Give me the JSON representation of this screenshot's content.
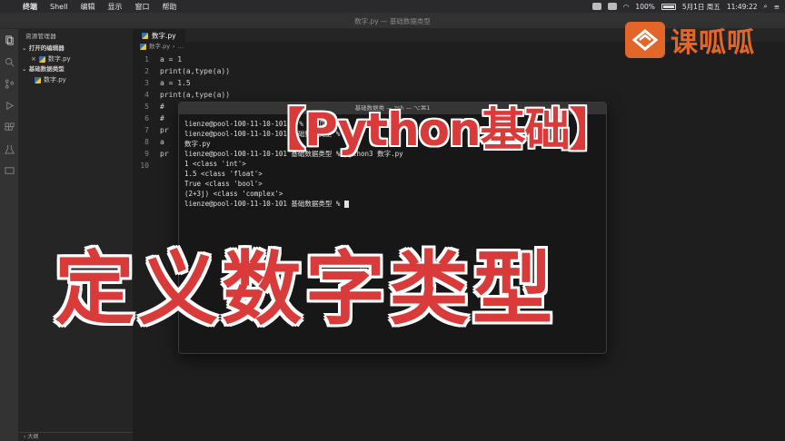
{
  "menubar": {
    "items": [
      "终端",
      "Shell",
      "编辑",
      "显示",
      "窗口",
      "帮助"
    ],
    "status": {
      "battery": "100%",
      "date": "5月1日 周五",
      "time": "11:49:22"
    }
  },
  "window": {
    "title": "数字.py — 基础数据类型"
  },
  "sidebar": {
    "header": "资源管理器",
    "open_editors_label": "打开的编辑器",
    "open_file": "数字.py",
    "folder_label": "基础数据类型",
    "folder_file": "数字.py",
    "outline_label": "大纲"
  },
  "editor": {
    "tab_label": "数字.py",
    "breadcrumb": "数字.py",
    "lines": [
      {
        "no": "1",
        "text": "a = 1"
      },
      {
        "no": "2",
        "text": "print(a,type(a))"
      },
      {
        "no": "3",
        "text": "a = 1.5"
      },
      {
        "no": "4",
        "text": "print(a,type(a))"
      },
      {
        "no": "5",
        "text": "#"
      },
      {
        "no": "6",
        "text": "#"
      },
      {
        "no": "7",
        "text": "pr"
      },
      {
        "no": "8",
        "text": "a"
      },
      {
        "no": "9",
        "text": "pr"
      },
      {
        "no": "10",
        "text": ""
      }
    ]
  },
  "terminal": {
    "title": "基础数据类 — zsh — ⌥⌘1",
    "lines": [
      "lienze@pool-100-11-10-101 ~ % cd Desktop",
      "lienze@pool-100-11-10-101 基础数据类型 % ls",
      "数字.py",
      "lienze@pool-100-11-10-101 基础数据类型 % python3 数字.py",
      "1 <class 'int'>",
      "1.5 <class 'float'>",
      "True <class 'bool'>",
      "(2+3j) <class 'complex'>",
      "lienze@pool-100-11-10-101 基础数据类型 % "
    ]
  },
  "overlay": {
    "title": "【Python基础】",
    "subtitle": "定义数字类型"
  },
  "watermark": {
    "brand": "课呱呱"
  },
  "colors": {
    "accent_red": "#d93a3a",
    "brand_orange": "#e2652a",
    "editor_bg": "#1e1e1e"
  }
}
